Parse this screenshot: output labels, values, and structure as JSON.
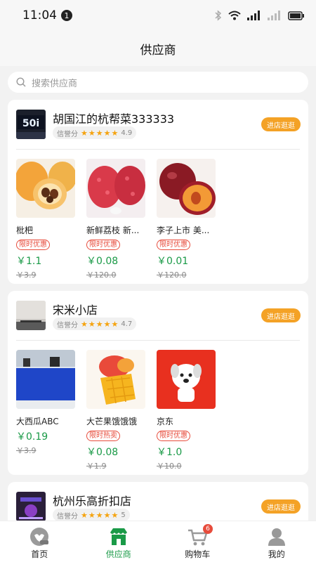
{
  "status_bar": {
    "time": "11:04",
    "notification_count": "1"
  },
  "header": {
    "title": "供应商"
  },
  "search": {
    "placeholder": "搜索供应商"
  },
  "credit_label": "信誉分",
  "enter_label": "进店逛逛",
  "stores": [
    {
      "name": "胡国江的杭帮菜333333",
      "rating": "4.9",
      "logo_text": "50i",
      "products": [
        {
          "name": "枇杷",
          "tag": "限时优惠",
          "price": "￥1.1",
          "original_price": "￥3.9",
          "image": "loquat"
        },
        {
          "name": "新鲜荔枝 新...",
          "tag": "限时优惠",
          "price": "￥0.08",
          "original_price": "￥120.0",
          "image": "lychee"
        },
        {
          "name": "李子上市 美...",
          "tag": "限时优惠",
          "price": "￥0.01",
          "original_price": "￥120.0",
          "image": "plum"
        }
      ]
    },
    {
      "name": "宋米小店",
      "rating": "4.7",
      "products": [
        {
          "name": "大西瓜ABC",
          "tag": "",
          "price": "￥0.19",
          "original_price": "￥3.9",
          "image": "office"
        },
        {
          "name": "大芒果饿饿饿",
          "tag": "限时热卖",
          "price": "￥0.08",
          "original_price": "￥1.9",
          "image": "mango"
        },
        {
          "name": "京东",
          "tag": "限时优惠",
          "price": "￥1.0",
          "original_price": "￥10.0",
          "image": "jd-dog"
        }
      ]
    },
    {
      "name": "杭州乐高折扣店",
      "rating": "5",
      "products": []
    }
  ],
  "tabs": [
    {
      "label": "首页",
      "icon": "home-icon"
    },
    {
      "label": "供应商",
      "icon": "store-icon",
      "active": true
    },
    {
      "label": "购物车",
      "icon": "cart-icon",
      "badge": "6"
    },
    {
      "label": "我的",
      "icon": "user-icon"
    }
  ],
  "colors": {
    "accent_green": "#1a9a47",
    "button_orange": "#f4a226",
    "tag_red": "#e74c3c"
  }
}
